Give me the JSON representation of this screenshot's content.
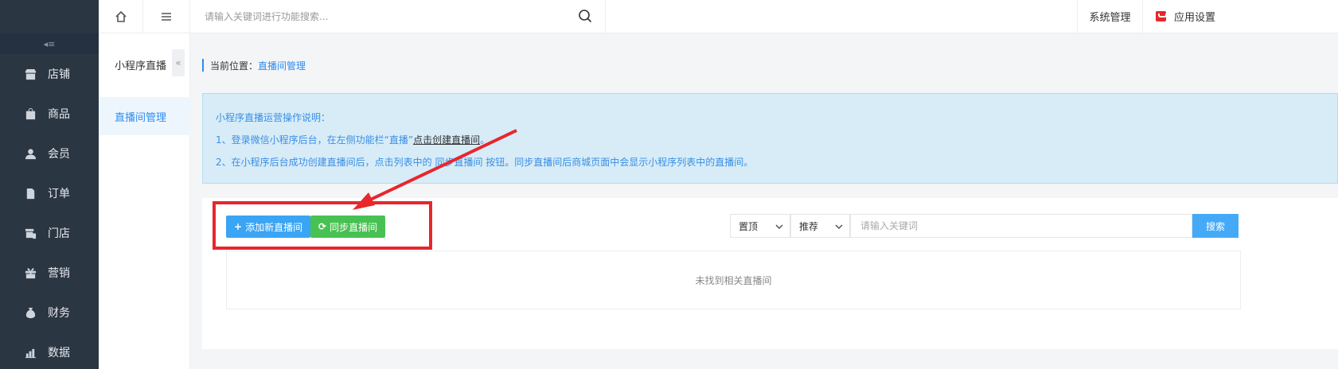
{
  "sidebar": {
    "items": [
      {
        "label": "店铺",
        "icon": "store-icon"
      },
      {
        "label": "商品",
        "icon": "goods-bag-icon"
      },
      {
        "label": "会员",
        "icon": "member-icon"
      },
      {
        "label": "订单",
        "icon": "order-doc-icon"
      },
      {
        "label": "门店",
        "icon": "shop-icon"
      },
      {
        "label": "营销",
        "icon": "gift-icon"
      },
      {
        "label": "财务",
        "icon": "money-bag-icon"
      },
      {
        "label": "数据",
        "icon": "chart-icon"
      }
    ]
  },
  "submenu": {
    "title": "小程序直播",
    "items": [
      {
        "label": "直播间管理"
      }
    ]
  },
  "topbar": {
    "search_placeholder": "请输入关键词进行功能搜索...",
    "system_label": "系统管理",
    "app_settings_label": "应用设置"
  },
  "breadcrumb": {
    "prefix": "当前位置：",
    "current": "直播间管理"
  },
  "notice": {
    "title": "小程序直播运营操作说明：",
    "line1_pre": "1、登录微信小程序后台，在左侧功能栏“直播”",
    "line1_link": "点击创建直播间",
    "line1_post": "。",
    "line2": "2、在小程序后台成功创建直播间后，点击列表中的 同步直播间 按钮。同步直播间后商城页面中会显示小程序列表中的直播间。"
  },
  "toolbar": {
    "add_label": "添加新直播间",
    "sync_label": "同步直播间",
    "filter_top": "置顶",
    "filter_recommend": "推荐",
    "keyword_placeholder": "请输入关键词",
    "search_label": "搜索"
  },
  "table": {
    "empty_text": "未找到相关直播间"
  },
  "colors": {
    "sidebar_bg": "#2b3643",
    "accent_blue": "#2d8cf0",
    "add_button": "#3aa4f5",
    "sync_button": "#48c153",
    "highlight_red": "#e8262c"
  }
}
